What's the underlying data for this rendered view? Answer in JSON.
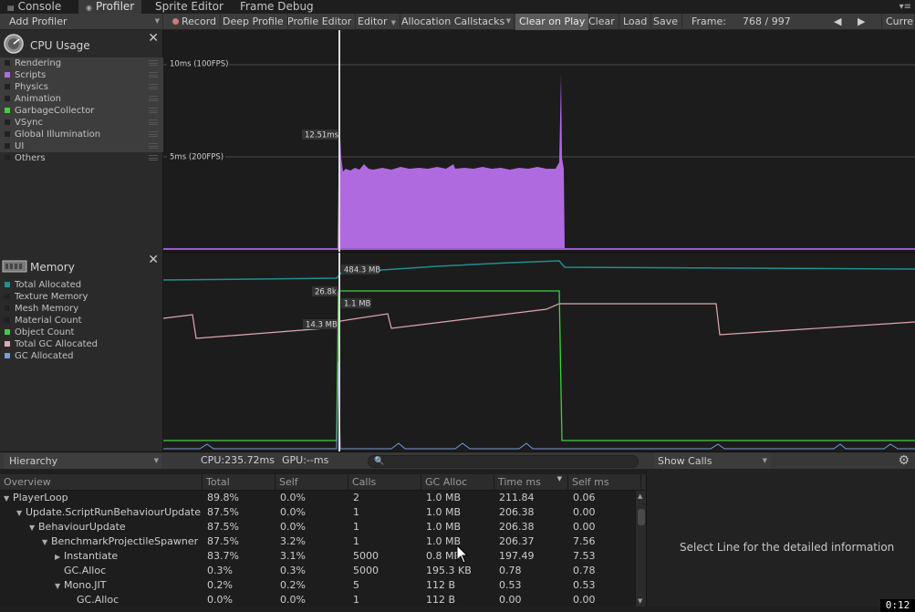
{
  "tabs": [
    {
      "label": "Console",
      "icon": "console-icon"
    },
    {
      "label": "Profiler",
      "icon": "profiler-icon",
      "active": true
    },
    {
      "label": "Sprite Editor"
    },
    {
      "label": "Frame Debug"
    }
  ],
  "toolbar": {
    "add_profiler": "Add Profiler",
    "record": "Record",
    "deep_profile": "Deep Profile",
    "profile_editor": "Profile Editor",
    "editor": "Editor",
    "allocation_callstacks": "Allocation Callstacks",
    "clear_on_play": "Clear on Play",
    "clear": "Clear",
    "load": "Load",
    "save": "Save",
    "frame_label": "Frame:",
    "frame_value": "768 / 997",
    "current": "Current"
  },
  "cpu_panel": {
    "title": "CPU Usage",
    "legend": [
      {
        "name": "Rendering",
        "color": "#222222"
      },
      {
        "name": "Scripts",
        "color": "#b06ae0"
      },
      {
        "name": "Physics",
        "color": "#222222"
      },
      {
        "name": "Animation",
        "color": "#222222"
      },
      {
        "name": "GarbageCollector",
        "color": "#3fcf3f"
      },
      {
        "name": "VSync",
        "color": "#222222"
      },
      {
        "name": "Global Illumination",
        "color": "#222222"
      },
      {
        "name": "UI",
        "color": "#222222"
      },
      {
        "name": "Others",
        "color": "#222222"
      }
    ],
    "labels": {
      "line10": "10ms (100FPS)",
      "line5": "5ms (200FPS)",
      "sel": "12.51ms"
    }
  },
  "memory_panel": {
    "title": "Memory",
    "legend": [
      {
        "name": "Total Allocated",
        "color": "#1f8f8f"
      },
      {
        "name": "Texture Memory",
        "color": "#222222"
      },
      {
        "name": "Mesh Memory",
        "color": "#222222"
      },
      {
        "name": "Material Count",
        "color": "#222222"
      },
      {
        "name": "Object Count",
        "color": "#3fcf3f"
      },
      {
        "name": "Total GC Allocated",
        "color": "#e0a8b0"
      },
      {
        "name": "GC Allocated",
        "color": "#7a9ad8"
      }
    ],
    "labels": {
      "total": "484.3 MB",
      "objects": "26.8k",
      "gc": "1.1 MB",
      "totalgc": "14.3 MB"
    }
  },
  "hierarchy_bar": {
    "view": "Hierarchy",
    "cpu": "CPU:235.72ms",
    "gpu": "GPU:--ms",
    "show_calls": "Show Calls"
  },
  "table": {
    "columns": [
      "Overview",
      "Total",
      "Self",
      "Calls",
      "GC Alloc",
      "Time ms",
      "Self ms"
    ],
    "rows": [
      {
        "indent": 0,
        "expander": "open",
        "name": "PlayerLoop",
        "total": "89.8%",
        "self": "0.0%",
        "calls": "2",
        "gc": "1.0 MB",
        "time": "211.84",
        "selfms": "0.06"
      },
      {
        "indent": 1,
        "expander": "open",
        "name": "Update.ScriptRunBehaviourUpdate",
        "total": "87.5%",
        "self": "0.0%",
        "calls": "1",
        "gc": "1.0 MB",
        "time": "206.38",
        "selfms": "0.00"
      },
      {
        "indent": 2,
        "expander": "open",
        "name": "BehaviourUpdate",
        "total": "87.5%",
        "self": "0.0%",
        "calls": "1",
        "gc": "1.0 MB",
        "time": "206.38",
        "selfms": "0.00"
      },
      {
        "indent": 3,
        "expander": "open",
        "name": "BenchmarkProjectileSpawner",
        "total": "87.5%",
        "self": "3.2%",
        "calls": "1",
        "gc": "1.0 MB",
        "time": "206.37",
        "selfms": "7.56"
      },
      {
        "indent": 4,
        "expander": "closed",
        "name": "Instantiate",
        "total": "83.7%",
        "self": "3.1%",
        "calls": "5000",
        "gc": "0.8 MB",
        "time": "197.49",
        "selfms": "7.53"
      },
      {
        "indent": 4,
        "expander": "none",
        "name": "GC.Alloc",
        "total": "0.3%",
        "self": "0.3%",
        "calls": "5000",
        "gc": "195.3 KB",
        "time": "0.78",
        "selfms": "0.78"
      },
      {
        "indent": 4,
        "expander": "open",
        "name": "Mono.JIT",
        "total": "0.2%",
        "self": "0.2%",
        "calls": "5",
        "gc": "112 B",
        "time": "0.53",
        "selfms": "0.53"
      },
      {
        "indent": 5,
        "expander": "none",
        "name": "GC.Alloc",
        "total": "0.0%",
        "self": "0.0%",
        "calls": "1",
        "gc": "112 B",
        "time": "0.00",
        "selfms": "0.00"
      }
    ]
  },
  "detail": {
    "message": "Select Line for the detailed information"
  },
  "clock": "0:12"
}
